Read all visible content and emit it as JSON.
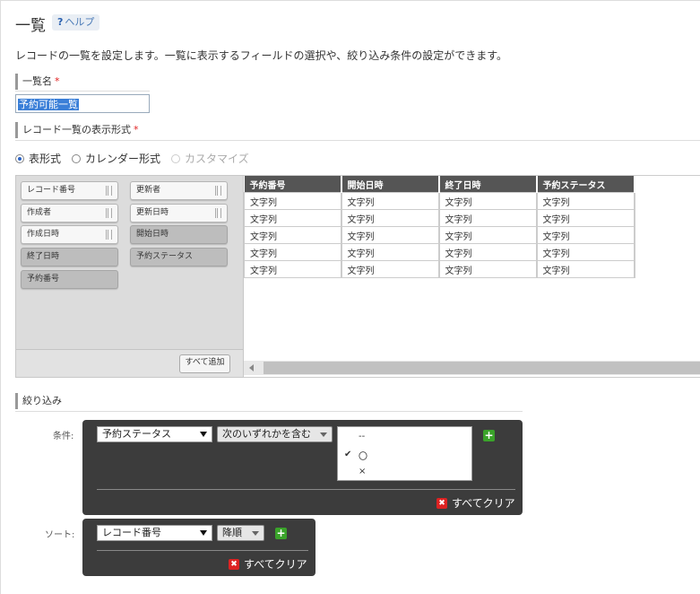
{
  "header": {
    "title": "一覧",
    "help_icon": "?",
    "help_label": "ヘルプ"
  },
  "description": "レコードの一覧を設定します。一覧に表示するフィールドの選択や、絞り込み条件の設定ができます。",
  "name_section": {
    "label": "一覧名",
    "required_mark": "*",
    "value": "予約可能一覧"
  },
  "format_section": {
    "label": "レコード一覧の表示形式",
    "required_mark": "*",
    "options": [
      {
        "label": "表形式",
        "selected": true,
        "disabled": false
      },
      {
        "label": "カレンダー形式",
        "selected": false,
        "disabled": false
      },
      {
        "label": "カスタマイズ",
        "selected": false,
        "disabled": true
      }
    ]
  },
  "palette": {
    "fields": [
      {
        "label": "レコード番号",
        "used": false
      },
      {
        "label": "更新者",
        "used": false
      },
      {
        "label": "作成者",
        "used": false
      },
      {
        "label": "更新日時",
        "used": false
      },
      {
        "label": "作成日時",
        "used": false
      },
      {
        "label": "開始日時",
        "used": true
      },
      {
        "label": "終了日時",
        "used": true
      },
      {
        "label": "予約ステータス",
        "used": true
      },
      {
        "label": "予約番号",
        "used": true
      }
    ],
    "add_all_label": "すべて追加"
  },
  "table": {
    "columns": [
      "予約番号",
      "開始日時",
      "終了日時",
      "予約ステータス"
    ],
    "rows": [
      [
        "文字列",
        "文字列",
        "文字列",
        "文字列"
      ],
      [
        "文字列",
        "文字列",
        "文字列",
        "文字列"
      ],
      [
        "文字列",
        "文字列",
        "文字列",
        "文字列"
      ],
      [
        "文字列",
        "文字列",
        "文字列",
        "文字列"
      ],
      [
        "文字列",
        "文字列",
        "文字列",
        "文字列"
      ]
    ]
  },
  "filter_section": {
    "label": "絞り込み",
    "condition_label": "条件:",
    "field": "予約ステータス",
    "operator": "次のいずれかを含む",
    "options": [
      {
        "label": "--",
        "checked": false
      },
      {
        "label": "〇",
        "checked": true
      },
      {
        "label": "×",
        "checked": false
      }
    ],
    "check_mark": "✔",
    "clear_label": "すべてクリア",
    "clear_icon": "✖",
    "add_icon": "+"
  },
  "sort_section": {
    "label": "ソート:",
    "field": "レコード番号",
    "order": "降順",
    "clear_label": "すべてクリア",
    "clear_icon": "✖",
    "add_icon": "+"
  }
}
